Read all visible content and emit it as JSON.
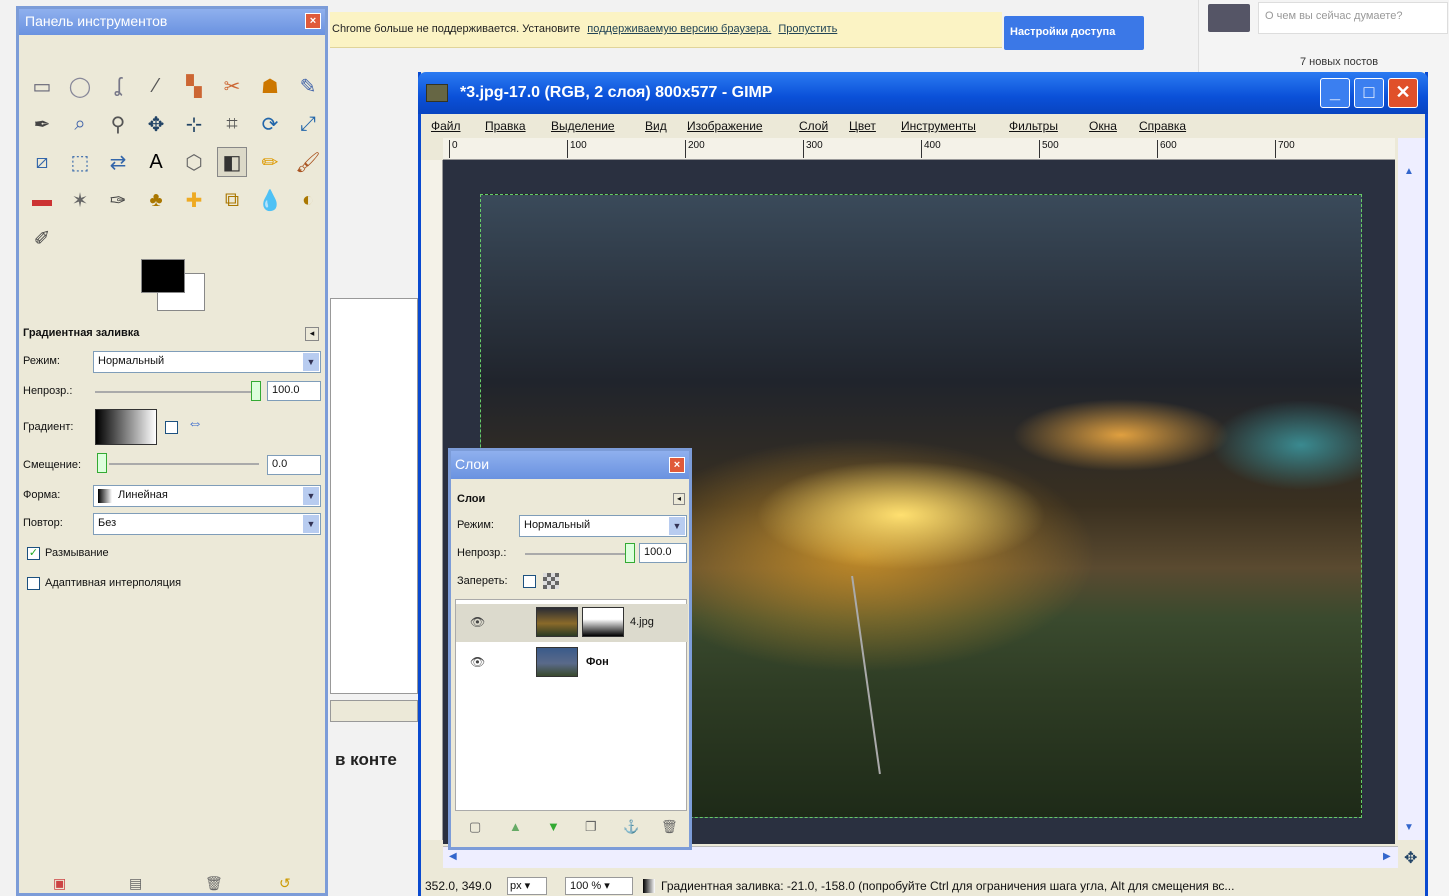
{
  "browser": {
    "infobar_text": "Chrome больше не поддерживается. Установите",
    "infobar_link": "поддерживаемую версию браузера.",
    "infobar_skip": "Пропустить",
    "access_button": "Настройки доступа",
    "status_input_placeholder": "О чем вы сейчас думаете?",
    "new_posts": "7 новых постов",
    "fragment_text": "в конте"
  },
  "toolbox": {
    "title": "Панель инструментов",
    "tool_icons": [
      "rect-select-icon",
      "ellipse-select-icon",
      "lasso-icon",
      "fuzzy-select-icon",
      "color-select-icon",
      "scissors-icon",
      "foreground-select-icon",
      "paths-icon",
      "color-picker-icon",
      "zoom-icon",
      "measure-icon",
      "move-icon",
      "align-icon",
      "crop-icon",
      "rotate-icon",
      "scale-icon",
      "shear-icon",
      "perspective-icon",
      "flip-icon",
      "text-icon",
      "transform-icon",
      "blend-icon",
      "pencil-icon",
      "paintbrush-icon",
      "eraser-icon",
      "airbrush-icon",
      "ink-icon",
      "clone-icon",
      "heal-icon",
      "perspective-clone-icon",
      "smudge-icon",
      "dodge-burn-icon"
    ],
    "options_title": "Градиентная заливка",
    "mode_label": "Режим:",
    "mode_value": "Нормальный",
    "opacity_label": "Непрозр.:",
    "opacity_value": "100.0",
    "gradient_label": "Градиент:",
    "offset_label": "Смещение:",
    "offset_value": "0.0",
    "shape_label": "Форма:",
    "shape_value": "Линейная",
    "repeat_label": "Повтор:",
    "repeat_value": "Без",
    "dither_label": "Размывание",
    "adaptive_label": "Адаптивная интерполяция"
  },
  "gimp": {
    "title": "*3.jpg-17.0 (RGB, 2 слоя) 800x577 - GIMP",
    "menu": [
      "Файл",
      "Правка",
      "Выделение",
      "Вид",
      "Изображение",
      "Слой",
      "Цвет",
      "Инструменты",
      "Фильтры",
      "Окна",
      "Справка"
    ],
    "ruler_marks": [
      "0",
      "100",
      "200",
      "300",
      "400",
      "500",
      "600",
      "700"
    ],
    "coords": "352.0, 349.0",
    "unit": "px",
    "zoom": "100 %",
    "status_text": "Градиентная заливка: -21.0, -158.0 (попробуйте Ctrl для ограничения шага угла, Alt для смещения вс..."
  },
  "layers": {
    "title": "Слои",
    "tab": "Слои",
    "mode_label": "Режим:",
    "mode_value": "Нормальный",
    "opacity_label": "Непрозр.:",
    "opacity_value": "100.0",
    "lock_label": "Запереть:",
    "items": [
      {
        "name": "4.jpg"
      },
      {
        "name": "Фон"
      }
    ]
  }
}
